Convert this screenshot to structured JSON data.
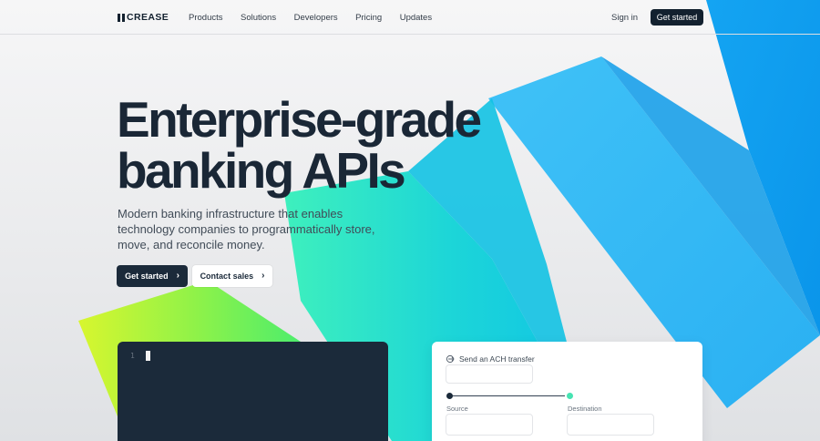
{
  "brand": {
    "logo_text": "CREASE",
    "logo_name": "Increase"
  },
  "nav": {
    "links": [
      "Products",
      "Solutions",
      "Developers",
      "Pricing",
      "Updates"
    ],
    "sign_in": "Sign in",
    "cta": "Get started"
  },
  "hero": {
    "title_lines": [
      "Enterprise-grade",
      "banking APIs"
    ],
    "subtitle_lines": [
      "Modern banking infrastructure that enables",
      "technology companies to programmatically store,",
      "move, and reconcile money."
    ],
    "primary_cta": "Get started",
    "secondary_cta": "Contact sales"
  },
  "code_editor": {
    "line_number": "1"
  },
  "transfer_card": {
    "title": "Send an ACH transfer",
    "source_label": "Source",
    "destination_label": "Destination"
  },
  "colors": {
    "navy": "#1b2a3a",
    "blue": "#33b8f6",
    "cyan": "#19c9e6",
    "teal": "#47e3b2",
    "green": "#5ef06a",
    "lime": "#d8f62e"
  },
  "icons": {
    "chevron": "chevron-right-icon",
    "transfer": "transfer-arrow-icon"
  }
}
